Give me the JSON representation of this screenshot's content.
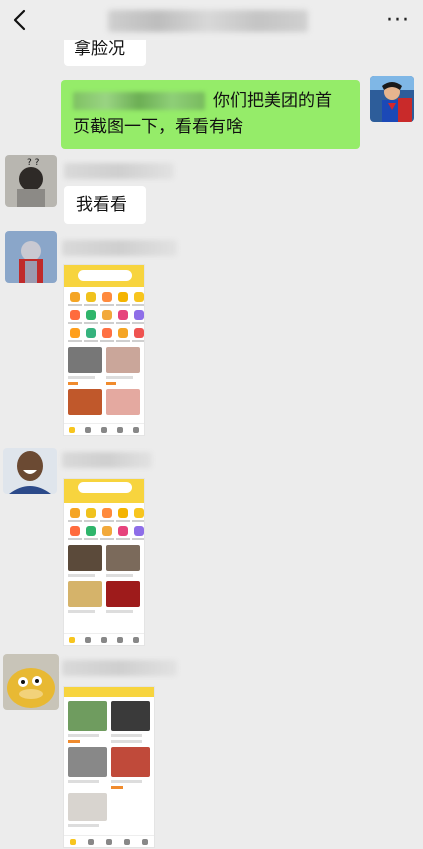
{
  "header": {
    "back_icon": "chevron-left-icon",
    "more_label": "···"
  },
  "messages": [
    {
      "side": "left",
      "text": "拿脸况"
    },
    {
      "side": "right",
      "text_line1": "你们把美团的首",
      "text_line2": "页截图一下，看看有啥"
    },
    {
      "side": "left",
      "text": "我看看"
    }
  ],
  "colors": {
    "green_bubble": "#95ec69",
    "meituan_yellow": "#f7d43e",
    "background": "#ececec"
  }
}
